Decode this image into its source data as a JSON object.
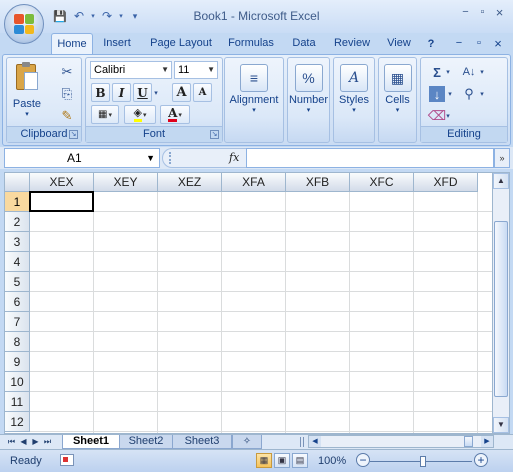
{
  "window": {
    "title": "Book1 - Microsoft Excel",
    "min": "−",
    "max": "▫",
    "close": "×"
  },
  "qat": {
    "save": "💾",
    "undo": "↶",
    "redo": "↷",
    "customize": "▾"
  },
  "tabs": [
    "Home",
    "Insert",
    "Page Layout",
    "Formulas",
    "Data",
    "Review",
    "View"
  ],
  "ribbon_ctrls": {
    "help": "?",
    "min": "−",
    "restore": "▫",
    "close": "×"
  },
  "clipboard": {
    "paste": "Paste",
    "label": "Clipboard",
    "cut_icon": "✂",
    "copy_icon": "⎘",
    "painter_icon": "✎"
  },
  "font": {
    "name": "Calibri",
    "size": "11",
    "bold": "B",
    "italic": "I",
    "underline": "U",
    "grow": "A",
    "shrink": "A",
    "fontcolor": "A",
    "label": "Font"
  },
  "alignment": {
    "label": "Alignment"
  },
  "number": {
    "label": "Number",
    "icon": "%"
  },
  "styles": {
    "label": "Styles",
    "icon": "A"
  },
  "cells": {
    "label": "Cells"
  },
  "editing": {
    "label": "Editing",
    "sum_icon": "Σ"
  },
  "namebox": {
    "value": "A1"
  },
  "fx": "fx",
  "expand": "»",
  "columns": [
    "XEX",
    "XEY",
    "XEZ",
    "XFA",
    "XFB",
    "XFC",
    "XFD"
  ],
  "rows": [
    "1",
    "2",
    "3",
    "4",
    "5",
    "6",
    "7",
    "8",
    "9",
    "10",
    "11",
    "12"
  ],
  "sheets": [
    "Sheet1",
    "Sheet2",
    "Sheet3"
  ],
  "status": {
    "ready": "Ready",
    "zoom": "100%",
    "minus": "−",
    "plus": "+"
  },
  "colors": {
    "accent": "#15428b",
    "selected_header": "#f9d99f"
  }
}
